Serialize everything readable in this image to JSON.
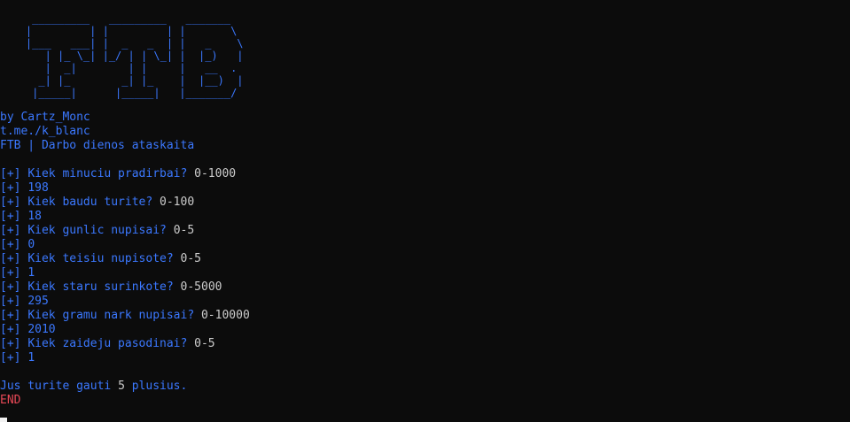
{
  "banner": {
    "art": "     _________   _________   _______\n    |         | |         | |       \\\n    |___   ___| |  _   _  | |   _    \\\n       | |_ \\_| |_/ | | \\_| |  |_)   |\n       |  _|        | |     |   __  .\n      _| |_        _| |_    |  |__)  |\n     |_____|      |_____|   |_______/",
    "color": "#3b78ff"
  },
  "intro": {
    "author": "by Cartz_Monc",
    "link": "t.me./k_blanc",
    "title": "FTB | Darbo dienos ataskaita"
  },
  "report": {
    "prefix": "[+]",
    "entries": [
      {
        "question": "Kiek minuciu pradirbai?",
        "range": "0-1000",
        "answer": "198"
      },
      {
        "question": "Kiek baudu turite?",
        "range": "0-100",
        "answer": "18"
      },
      {
        "question": "Kiek gunlic nupisai?",
        "range": "0-5",
        "answer": "0"
      },
      {
        "question": "Kiek teisiu nupisote?",
        "range": "0-5",
        "answer": "1"
      },
      {
        "question": "Kiek staru surinkote?",
        "range": "0-5000",
        "answer": "295"
      },
      {
        "question": "Kiek gramu nark nupisai?",
        "range": "0-10000",
        "answer": "2010"
      },
      {
        "question": "Kiek zaideju pasodinai?",
        "range": "0-5",
        "answer": "1"
      }
    ]
  },
  "result": {
    "before": "Jus turite gauti",
    "value": "5",
    "after": "plusius."
  },
  "end_label": "END",
  "colors": {
    "background": "#0c0c0c",
    "accent_blue": "#3b78ff",
    "value_white": "#cccccc",
    "end_red": "#e74856"
  }
}
